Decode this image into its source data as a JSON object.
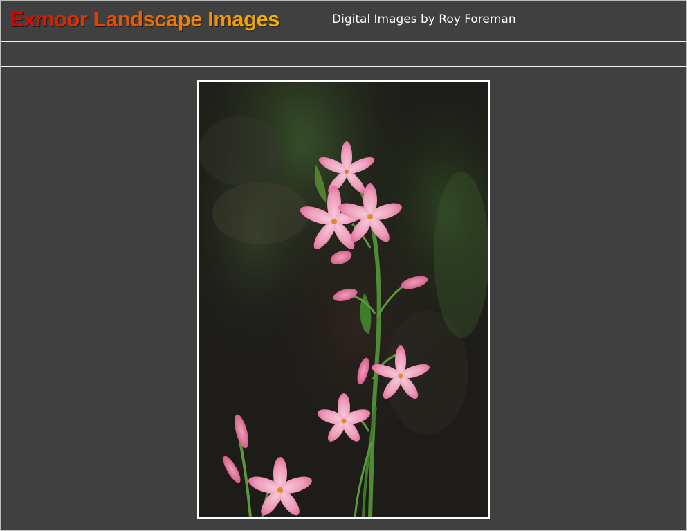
{
  "header": {
    "title": "Exmoor Landscape Images",
    "subtitle": "Digital Images by Roy Foreman"
  },
  "main": {
    "photo_subject": "pink-flower-stem-photo"
  },
  "colors": {
    "background": "#404040",
    "title_gradient_start": "#d40000",
    "title_gradient_end": "#f4b400",
    "subtitle_text": "#ffffff",
    "rule": "#f2f2f2",
    "photo_border": "#ffffff"
  }
}
